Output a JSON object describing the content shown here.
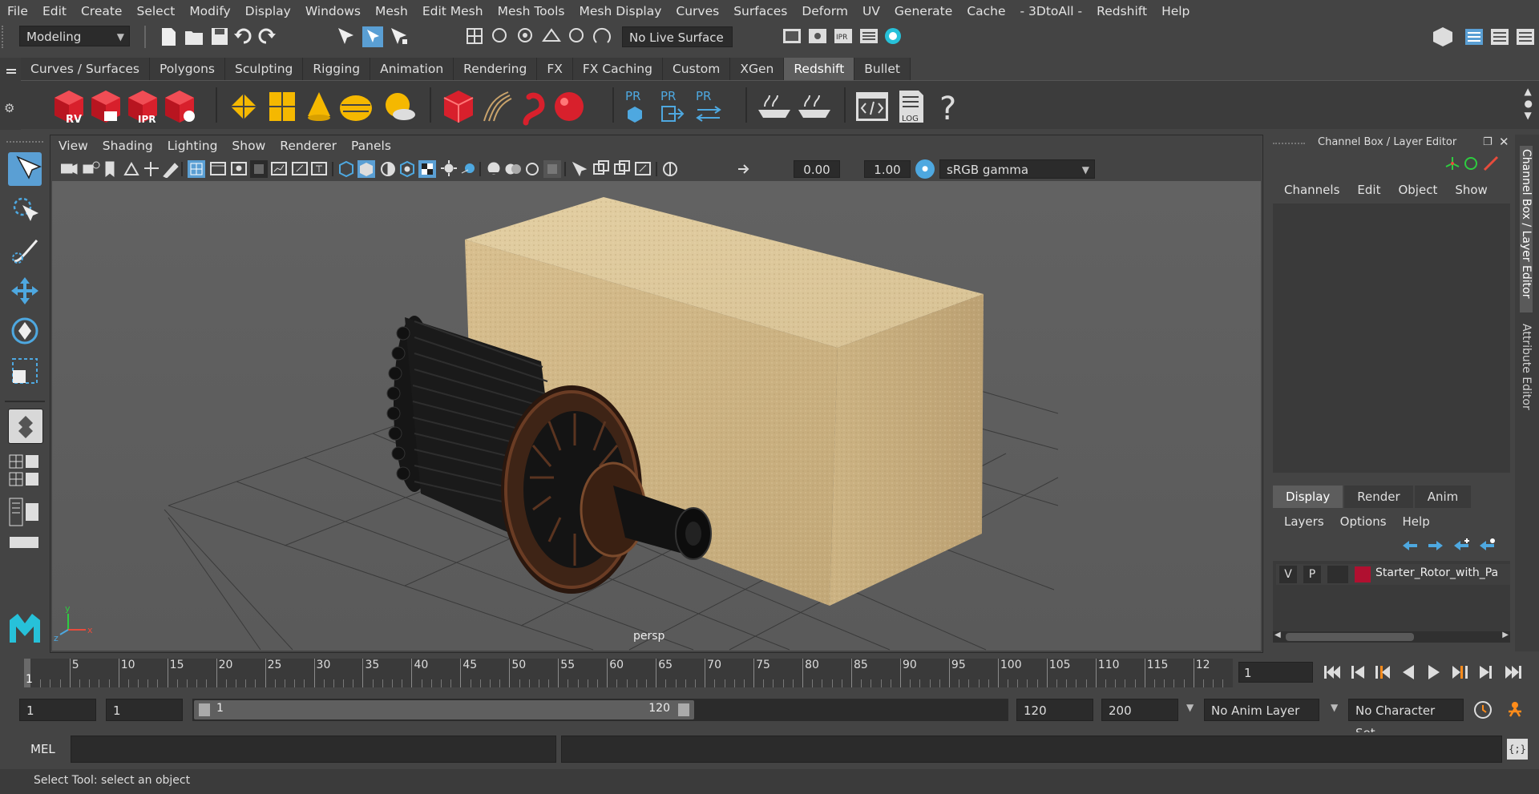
{
  "menu": [
    "File",
    "Edit",
    "Create",
    "Select",
    "Modify",
    "Display",
    "Windows",
    "Mesh",
    "Edit Mesh",
    "Mesh Tools",
    "Mesh Display",
    "Curves",
    "Surfaces",
    "Deform",
    "UV",
    "Generate",
    "Cache",
    "- 3DtoAll -",
    "Redshift",
    "Help"
  ],
  "status": {
    "mode": "Modeling",
    "live_surface": "No Live Surface"
  },
  "shelf_tabs": [
    "Curves / Surfaces",
    "Polygons",
    "Sculpting",
    "Rigging",
    "Animation",
    "Rendering",
    "FX",
    "FX Caching",
    "Custom",
    "XGen",
    "Redshift",
    "Bullet"
  ],
  "shelf_active": "Redshift",
  "shelf_labels": {
    "rv": "RV",
    "ipr": "IPR",
    "pr1": "PR",
    "pr2": "PR",
    "pr3": "PR",
    "log": "LOG",
    "help": "?"
  },
  "viewport": {
    "menu": [
      "View",
      "Shading",
      "Lighting",
      "Show",
      "Renderer",
      "Panels"
    ],
    "exposure": "0.00",
    "gamma": "1.00",
    "colorspace": "sRGB gamma",
    "camera": "persp",
    "axis": {
      "x": "x",
      "y": "y",
      "z": "z"
    }
  },
  "channel_box": {
    "title": "Channel Box / Layer Editor",
    "menu": [
      "Channels",
      "Edit",
      "Object",
      "Show"
    ]
  },
  "layer_editor": {
    "tabs": [
      "Display",
      "Render",
      "Anim"
    ],
    "menu": [
      "Layers",
      "Options",
      "Help"
    ],
    "layer": {
      "v": "V",
      "p": "P",
      "name": "Starter_Rotor_with_Pa",
      "color": "#b01030"
    }
  },
  "side_tabs": [
    "Channel Box / Layer Editor",
    "Attribute Editor"
  ],
  "timeline": {
    "labels": [
      "5",
      "10",
      "15",
      "20",
      "25",
      "30",
      "35",
      "40",
      "45",
      "50",
      "55",
      "60",
      "65",
      "70",
      "75",
      "80",
      "85",
      "90",
      "95",
      "100",
      "105",
      "110",
      "115",
      "12"
    ],
    "current_frame": "1",
    "frame_field": "1"
  },
  "range": {
    "start": "1",
    "playback_start": "1",
    "slider_start": "1",
    "slider_end": "120",
    "playback_end": "120",
    "end": "200",
    "anim_layer": "No Anim Layer",
    "char_set": "No Character Set"
  },
  "command": {
    "label": "MEL"
  },
  "help_line": "Select Tool: select an object",
  "colors": {
    "accent": "#5a9fd4",
    "redshift": "#d8202c",
    "yellow": "#f5b800",
    "cyan": "#27c1d9"
  }
}
